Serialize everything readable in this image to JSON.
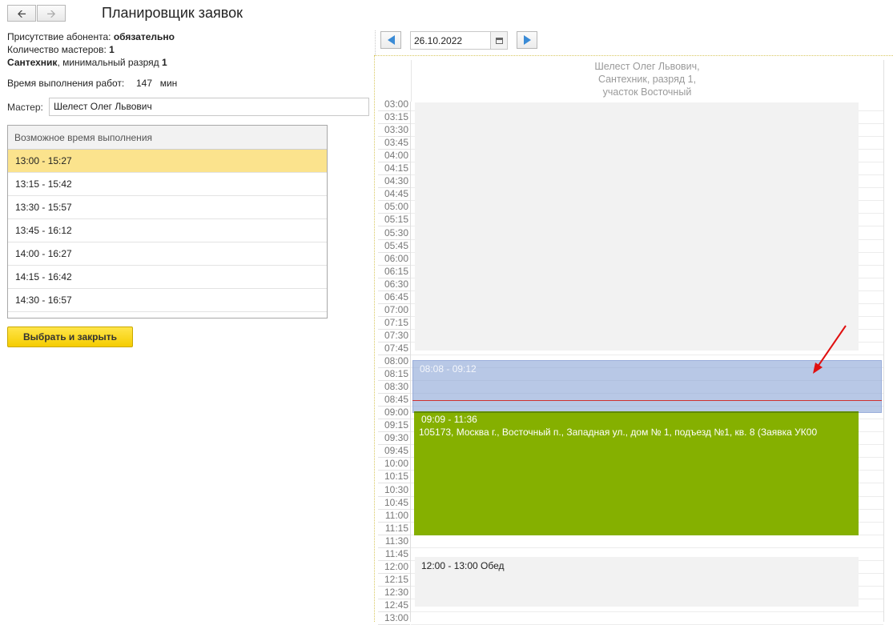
{
  "window": {
    "title": "Планировщик заявок",
    "back_icon": "arrow-left-icon",
    "forward_icon": "arrow-right-icon"
  },
  "info": {
    "presence_label": "Присутствие абонента:",
    "presence_value": "обязательно",
    "masters_count_label": "Количество мастеров:",
    "masters_count_value": "1",
    "specialty": "Сантехник",
    "grade_label": ", минимальный разряд",
    "grade_value": "1",
    "duration_label": "Время выполнения работ:",
    "duration_value": "147",
    "duration_unit": "мин"
  },
  "master": {
    "label": "Мастер:",
    "value": "Шелест Олег Львович"
  },
  "time_table": {
    "header": "Возможное время выполнения",
    "rows": [
      "13:00 - 15:27",
      "13:15 - 15:42",
      "13:30 - 15:57",
      "13:45 - 16:12",
      "14:00 - 16:27",
      "14:15 - 16:42",
      "14:30 - 16:57"
    ],
    "selected_index": 0
  },
  "choose_button": "Выбрать и закрыть",
  "date_nav": {
    "date": "26.10.2022",
    "prev_icon": "arrow-left-blue-icon",
    "next_icon": "arrow-right-blue-icon",
    "calendar_icon": "calendar-icon"
  },
  "planner": {
    "resource_lines": [
      "Шелест Олег Львович,",
      "Сантехник, разряд 1,",
      "участок Восточный"
    ],
    "time_labels": [
      "03:00",
      "03:15",
      "03:30",
      "03:45",
      "04:00",
      "04:15",
      "04:30",
      "04:45",
      "05:00",
      "05:15",
      "05:30",
      "05:45",
      "06:00",
      "06:15",
      "06:30",
      "06:45",
      "07:00",
      "07:15",
      "07:30",
      "07:45",
      "08:00",
      "08:15",
      "08:30",
      "08:45",
      "09:00",
      "09:15",
      "09:30",
      "09:45",
      "10:00",
      "10:15",
      "10:30",
      "10:45",
      "11:00",
      "11:15",
      "11:30",
      "11:45",
      "12:00",
      "12:15",
      "12:30",
      "12:45",
      "13:00"
    ],
    "blue_event_time": "08:08 - 09:12",
    "green_event_time": "09:09 - 11:36",
    "green_event_address": "105173, Москва г., Восточный п., Западная ул., дом № 1, подъезд №1, кв. 8 (Заявка УК00",
    "lunch_label": "12:00 - 13:00 Обед",
    "colors": {
      "selected_row": "#fbe38d",
      "choose_button": "#f5cc00",
      "blue_event": "#8da6d6",
      "green_event": "#85b000",
      "now_line": "#d03030",
      "arrow": "#e01010"
    }
  }
}
